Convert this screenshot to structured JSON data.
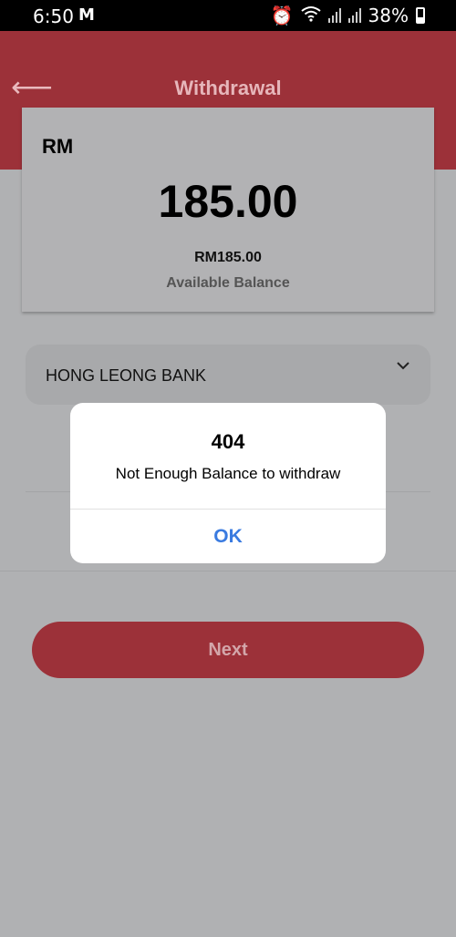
{
  "status_bar": {
    "time": "6:50",
    "mail_icon": "M",
    "battery": "38%"
  },
  "header": {
    "title": "Withdrawal",
    "back_icon": "⟵"
  },
  "balance_card": {
    "currency": "RM",
    "amount": "185.00",
    "amount_with_currency": "RM185.00",
    "label": "Available Balance"
  },
  "bank_select": {
    "selected": "HONG LEONG BANK",
    "chevron_icon": "⌄"
  },
  "next_button": {
    "label": "Next"
  },
  "dialog": {
    "title": "404",
    "message": "Not Enough Balance to withdraw",
    "ok_label": "OK"
  }
}
